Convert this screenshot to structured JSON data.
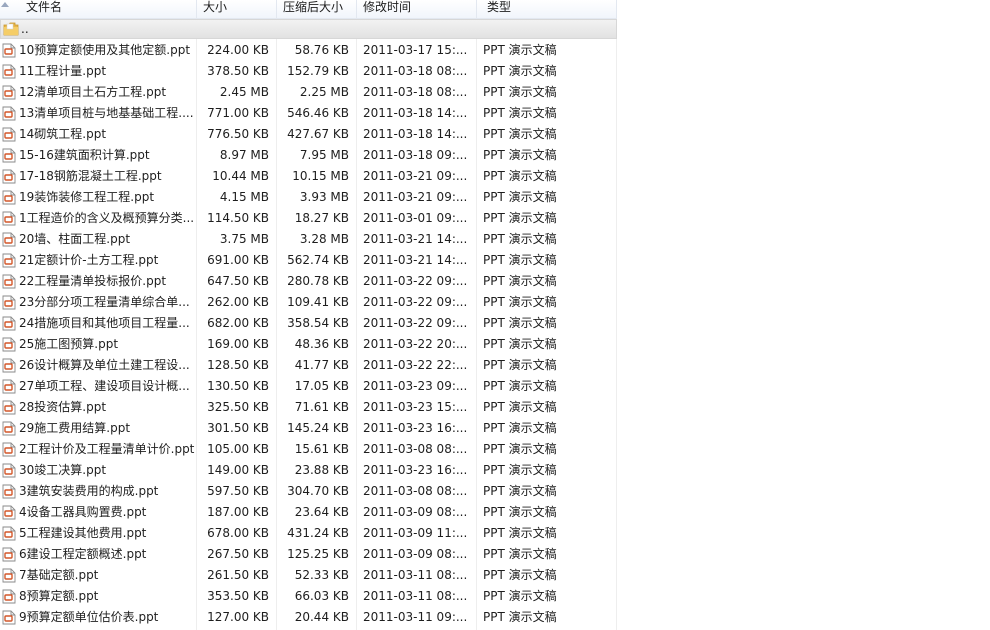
{
  "columns": {
    "name": "文件名",
    "size": "大小",
    "compressed": "压缩后大小",
    "modified": "修改时间",
    "type": "类型"
  },
  "parent": {
    "label": "..",
    "icon": "folder-icon"
  },
  "file_icon": "ppt-file-icon",
  "files": [
    {
      "name": "10预算定额使用及其他定额.ppt",
      "size": "224.00 KB",
      "compressed": "58.76 KB",
      "modified": "2011-03-17  15:...",
      "type": "PPT 演示文稿"
    },
    {
      "name": "11工程计量.ppt",
      "size": "378.50 KB",
      "compressed": "152.79 KB",
      "modified": "2011-03-18  08:...",
      "type": "PPT 演示文稿"
    },
    {
      "name": "12清单项目土石方工程.ppt",
      "size": "2.45 MB",
      "compressed": "2.25 MB",
      "modified": "2011-03-18  08:...",
      "type": "PPT 演示文稿"
    },
    {
      "name": "13清单项目桩与地基基础工程....",
      "size": "771.00 KB",
      "compressed": "546.46 KB",
      "modified": "2011-03-18  14:...",
      "type": "PPT 演示文稿"
    },
    {
      "name": "14砌筑工程.ppt",
      "size": "776.50 KB",
      "compressed": "427.67 KB",
      "modified": "2011-03-18  14:...",
      "type": "PPT 演示文稿"
    },
    {
      "name": "15-16建筑面积计算.ppt",
      "size": "8.97 MB",
      "compressed": "7.95 MB",
      "modified": "2011-03-18  09:...",
      "type": "PPT 演示文稿"
    },
    {
      "name": "17-18钢筋混凝土工程.ppt",
      "size": "10.44 MB",
      "compressed": "10.15 MB",
      "modified": "2011-03-21  09:...",
      "type": "PPT 演示文稿"
    },
    {
      "name": "19装饰装修工程工程.ppt",
      "size": "4.15 MB",
      "compressed": "3.93 MB",
      "modified": "2011-03-21  09:...",
      "type": "PPT 演示文稿"
    },
    {
      "name": "1工程造价的含义及概预算分类...",
      "size": "114.50 KB",
      "compressed": "18.27 KB",
      "modified": "2011-03-01  09:...",
      "type": "PPT 演示文稿"
    },
    {
      "name": "20墙、柱面工程.ppt",
      "size": "3.75 MB",
      "compressed": "3.28 MB",
      "modified": "2011-03-21  14:...",
      "type": "PPT 演示文稿"
    },
    {
      "name": "21定额计价-土方工程.ppt",
      "size": "691.00 KB",
      "compressed": "562.74 KB",
      "modified": "2011-03-21  14:...",
      "type": "PPT 演示文稿"
    },
    {
      "name": "22工程量清单投标报价.ppt",
      "size": "647.50 KB",
      "compressed": "280.78 KB",
      "modified": "2011-03-22  09:...",
      "type": "PPT 演示文稿"
    },
    {
      "name": "23分部分项工程量清单综合单...",
      "size": "262.00 KB",
      "compressed": "109.41 KB",
      "modified": "2011-03-22  09:...",
      "type": "PPT 演示文稿"
    },
    {
      "name": "24措施项目和其他项目工程量...",
      "size": "682.00 KB",
      "compressed": "358.54 KB",
      "modified": "2011-03-22  09:...",
      "type": "PPT 演示文稿"
    },
    {
      "name": "25施工图预算.ppt",
      "size": "169.00 KB",
      "compressed": "48.36 KB",
      "modified": "2011-03-22  20:...",
      "type": "PPT 演示文稿"
    },
    {
      "name": "26设计概算及单位土建工程设...",
      "size": "128.50 KB",
      "compressed": "41.77 KB",
      "modified": "2011-03-22  22:...",
      "type": "PPT 演示文稿"
    },
    {
      "name": "27单项工程、建设项目设计概...",
      "size": "130.50 KB",
      "compressed": "17.05 KB",
      "modified": "2011-03-23  09:...",
      "type": "PPT 演示文稿"
    },
    {
      "name": "28投资估算.ppt",
      "size": "325.50 KB",
      "compressed": "71.61 KB",
      "modified": "2011-03-23  15:...",
      "type": "PPT 演示文稿"
    },
    {
      "name": "29施工费用结算.ppt",
      "size": "301.50 KB",
      "compressed": "145.24 KB",
      "modified": "2011-03-23  16:...",
      "type": "PPT 演示文稿"
    },
    {
      "name": "2工程计价及工程量清单计价.ppt",
      "size": "105.00 KB",
      "compressed": "15.61 KB",
      "modified": "2011-03-08  08:...",
      "type": "PPT 演示文稿"
    },
    {
      "name": "30竣工决算.ppt",
      "size": "149.00 KB",
      "compressed": "23.88 KB",
      "modified": "2011-03-23  16:...",
      "type": "PPT 演示文稿"
    },
    {
      "name": "3建筑安装费用的构成.ppt",
      "size": "597.50 KB",
      "compressed": "304.70 KB",
      "modified": "2011-03-08  08:...",
      "type": "PPT 演示文稿"
    },
    {
      "name": "4设备工器具购置费.ppt",
      "size": "187.00 KB",
      "compressed": "23.64 KB",
      "modified": "2011-03-09  08:...",
      "type": "PPT 演示文稿"
    },
    {
      "name": "5工程建设其他费用.ppt",
      "size": "678.00 KB",
      "compressed": "431.24 KB",
      "modified": "2011-03-09  11:...",
      "type": "PPT 演示文稿"
    },
    {
      "name": "6建设工程定额概述.ppt",
      "size": "267.50 KB",
      "compressed": "125.25 KB",
      "modified": "2011-03-09  08:...",
      "type": "PPT 演示文稿"
    },
    {
      "name": "7基础定额.ppt",
      "size": "261.50 KB",
      "compressed": "52.33 KB",
      "modified": "2011-03-11  08:...",
      "type": "PPT 演示文稿"
    },
    {
      "name": "8预算定额.ppt",
      "size": "353.50 KB",
      "compressed": "66.03 KB",
      "modified": "2011-03-11  08:...",
      "type": "PPT 演示文稿"
    },
    {
      "name": "9预算定额单位估价表.ppt",
      "size": "127.00 KB",
      "compressed": "20.44 KB",
      "modified": "2011-03-11  09:...",
      "type": "PPT 演示文稿"
    }
  ]
}
